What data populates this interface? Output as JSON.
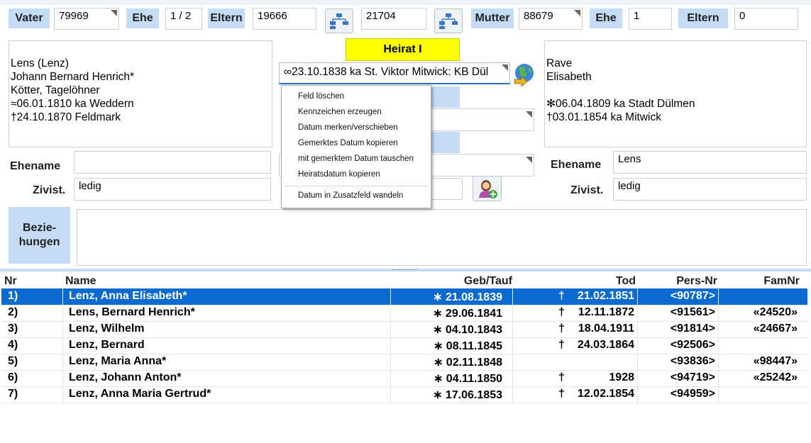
{
  "top": {
    "vater_label": "Vater",
    "vater_value": "79969",
    "ehe_label": "Ehe",
    "ehe_value": "1 / 2",
    "eltern_label": "Eltern",
    "eltern_value": "19666",
    "middle_value": "21704",
    "mutter_label": "Mutter",
    "mutter_value": "88679",
    "ehe2_label": "Ehe",
    "ehe2_value": "1",
    "eltern2_label": "Eltern",
    "eltern2_value": "0"
  },
  "father": {
    "lines": [
      "Lens (Lenz)",
      "Johann Bernard Henrich*",
      "Kötter, Tagelöhner",
      "≈06.01.1810 ka Weddern",
      "†24.10.1870 Feldmark"
    ],
    "ehename_label": "Ehename",
    "ehename_value": "",
    "zivist_label": "Zivist.",
    "zivist_value": "ledig"
  },
  "marriage": {
    "title": "Heirat I",
    "date_field": "∞23.10.1838 ka St. Viktor Mitwick: KB Dül"
  },
  "mother": {
    "lines": [
      "Rave",
      "Elisabeth",
      "",
      "✻06.04.1809 ka Stadt Dülmen",
      "†03.01.1854 ka Mitwick"
    ],
    "ehename_label": "Ehename",
    "ehename_value": "Lens",
    "zivist_label": "Zivist.",
    "zivist_value": "ledig"
  },
  "beziehungen": {
    "label_line1": "Bezie-",
    "label_line2": "hungen"
  },
  "context_menu": [
    "Feld löschen",
    "Kennzeichen erzeugen",
    "Datum merken/verschieben",
    "Gemerktes Datum kopieren",
    "mit gemerktem Datum tauschen",
    "Heiratsdatum kopieren",
    "Datum in Zusatzfeld wandeln"
  ],
  "table": {
    "headers": {
      "nr": "Nr",
      "name": "Name",
      "geb": "Geb/Tauf",
      "tod": "Tod",
      "pers": "Pers-Nr",
      "fam": "FamNr"
    },
    "rows": [
      {
        "nr": "1)",
        "name": "Lenz, Anna Elisabeth*",
        "geb": "∗ 21.08.1839",
        "tod_sym": "†",
        "tod": "21.02.1851",
        "pers": "<90787>",
        "fam": ""
      },
      {
        "nr": "2)",
        "name": "Lens, Bernard Henrich*",
        "geb": "∗ 29.06.1841",
        "tod_sym": "†",
        "tod": "12.11.1872",
        "pers": "<91561>",
        "fam": "«24520»"
      },
      {
        "nr": "3)",
        "name": "Lenz, Wilhelm",
        "geb": "∗ 04.10.1843",
        "tod_sym": "†",
        "tod": "18.04.1911",
        "pers": "<91814>",
        "fam": "«24667»"
      },
      {
        "nr": "4)",
        "name": "Lenz, Bernard",
        "geb": "∗ 08.11.1845",
        "tod_sym": "†",
        "tod": "24.03.1864",
        "pers": "<92506>",
        "fam": ""
      },
      {
        "nr": "5)",
        "name": "Lenz, Maria Anna*",
        "geb": "∗ 02.11.1848",
        "tod_sym": "",
        "tod": "",
        "pers": "<93836>",
        "fam": "«98447»"
      },
      {
        "nr": "6)",
        "name": "Lenz, Johann Anton*",
        "geb": "∗ 04.11.1850",
        "tod_sym": "†",
        "tod": "1928",
        "pers": "<94719>",
        "fam": "«25242»"
      },
      {
        "nr": "7)",
        "name": "Lenz, Anna Maria Gertrud*",
        "geb": "∗ 17.06.1853",
        "tod_sym": "†",
        "tod": "12.02.1854",
        "pers": "<94959>",
        "fam": ""
      }
    ]
  },
  "colors": {
    "label_bg": "#c4dcf6",
    "heirat_bg": "#ffff00",
    "selection": "#0a6ad0"
  },
  "icons": [
    "family-tree-icon",
    "globe-arrow-icon",
    "add-person-icon",
    "dropdown-corner-icon"
  ]
}
